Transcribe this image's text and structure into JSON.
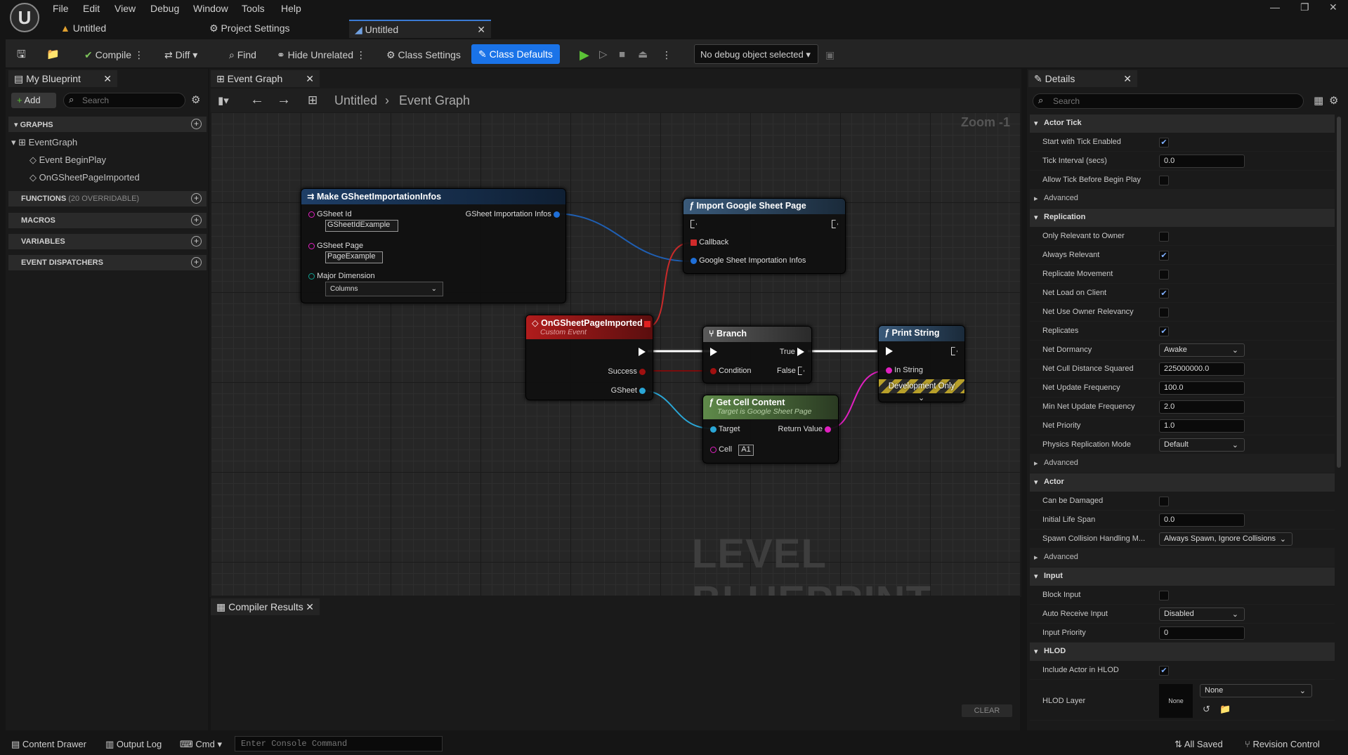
{
  "menu": [
    "File",
    "Edit",
    "View",
    "Debug",
    "Window",
    "Tools",
    "Help"
  ],
  "doc_tabs": [
    "Untitled",
    "Project Settings",
    "Untitled"
  ],
  "toolbar": {
    "compile": "Compile",
    "diff": "Diff",
    "find": "Find",
    "hide_unrelated": "Hide Unrelated",
    "class_settings": "Class Settings",
    "class_defaults": "Class Defaults",
    "debug_object": "No debug object selected"
  },
  "my_blueprint": {
    "tab": "My Blueprint",
    "add": "Add",
    "search_placeholder": "Search",
    "graphs": "GRAPHS",
    "event_graph": "EventGraph",
    "items": [
      "Event BeginPlay",
      "OnGSheetPageImported"
    ],
    "functions": "FUNCTIONS",
    "functions_note": "(20 OVERRIDABLE)",
    "macros": "MACROS",
    "variables": "VARIABLES",
    "dispatchers": "EVENT DISPATCHERS"
  },
  "graph": {
    "tab": "Event Graph",
    "breadcrumb_root": "Untitled",
    "breadcrumb_leaf": "Event Graph",
    "zoom": "Zoom -1",
    "watermark": "LEVEL BLUEPRINT"
  },
  "nodes": {
    "make": {
      "title": "Make GSheetImportationInfos",
      "sheet_id_label": "GSheet Id",
      "sheet_id_value": "GSheetIdExample",
      "sheet_page_label": "GSheet Page",
      "sheet_page_value": "PageExample",
      "major_label": "Major Dimension",
      "major_value": "Columns",
      "out": "GSheet Importation Infos"
    },
    "import": {
      "title": "Import Google Sheet Page",
      "callback": "Callback",
      "infos": "Google Sheet Importation Infos"
    },
    "event": {
      "title": "OnGSheetPageImported",
      "subtitle": "Custom Event",
      "success": "Success",
      "gsheet": "GSheet"
    },
    "branch": {
      "title": "Branch",
      "condition": "Condition",
      "true_label": "True",
      "false_label": "False"
    },
    "print": {
      "title": "Print String",
      "in_string": "In String",
      "dev": "Development Only"
    },
    "cell": {
      "title": "Get Cell Content",
      "subtitle": "Target is Google Sheet Page",
      "target": "Target",
      "return_value": "Return Value",
      "cell": "Cell",
      "cell_value": "A1"
    }
  },
  "compiler": {
    "tab": "Compiler Results",
    "clear": "CLEAR"
  },
  "details": {
    "tab": "Details",
    "search_placeholder": "Search",
    "sections": {
      "actor_tick": "Actor Tick",
      "replication": "Replication",
      "actor": "Actor",
      "input": "Input",
      "hlod": "HLOD",
      "advanced": "Advanced"
    },
    "rows": {
      "start_tick": "Start with Tick Enabled",
      "tick_interval": "Tick Interval (secs)",
      "tick_interval_v": "0.0",
      "allow_tick": "Allow Tick Before Begin Play",
      "only_relevant": "Only Relevant to Owner",
      "always_relevant": "Always Relevant",
      "replicate_movement": "Replicate Movement",
      "net_load": "Net Load on Client",
      "net_owner": "Net Use Owner Relevancy",
      "replicates": "Replicates",
      "net_dormancy": "Net Dormancy",
      "net_dormancy_v": "Awake",
      "net_cull": "Net Cull Distance Squared",
      "net_cull_v": "225000000.0",
      "net_update": "Net Update Frequency",
      "net_update_v": "100.0",
      "min_net": "Min Net Update Frequency",
      "min_net_v": "2.0",
      "net_priority": "Net Priority",
      "net_priority_v": "1.0",
      "physics_rep": "Physics Replication Mode",
      "physics_rep_v": "Default",
      "can_damaged": "Can be Damaged",
      "life_span": "Initial Life Span",
      "life_span_v": "0.0",
      "spawn_coll": "Spawn Collision Handling M...",
      "spawn_coll_v": "Always Spawn, Ignore Collisions",
      "block_input": "Block Input",
      "auto_receive": "Auto Receive Input",
      "auto_receive_v": "Disabled",
      "input_priority": "Input Priority",
      "input_priority_v": "0",
      "include_hlod": "Include Actor in HLOD",
      "hlod_layer": "HLOD Layer",
      "hlod_thumb": "None",
      "hlod_layer_v": "None"
    }
  },
  "status": {
    "content_drawer": "Content Drawer",
    "output_log": "Output Log",
    "cmd": "Cmd",
    "console_placeholder": "Enter Console Command",
    "all_saved": "All Saved",
    "revision": "Revision Control"
  },
  "colors": {
    "accent": "#1a73e8",
    "exec_wire": "#ffffff",
    "struct_wire": "#1f5fb3",
    "object_wire": "#2aa6d6",
    "string_wire": "#e020c0",
    "bool_wire": "#a01010",
    "event_header": "#b01c1c",
    "pure_header": "#4f7a3a",
    "func_header": "#2a4a6a"
  }
}
